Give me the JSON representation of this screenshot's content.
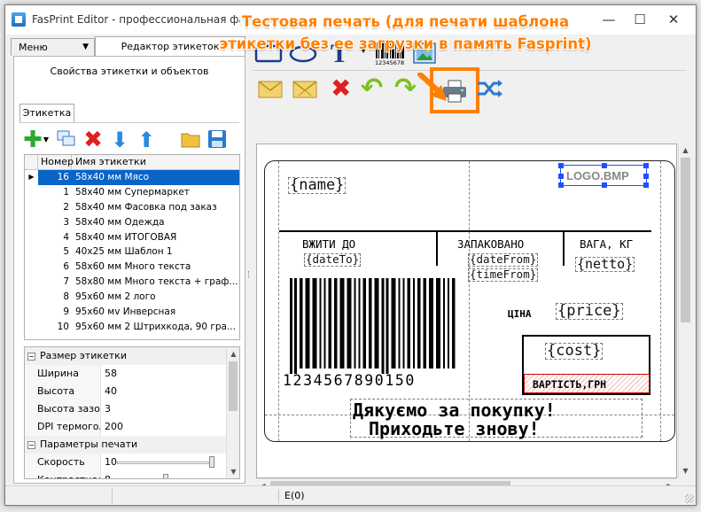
{
  "window": {
    "title": "FasPrint Editor - профессиональная фасо",
    "minimize": "—",
    "maximize": "☐",
    "close": "✕"
  },
  "overlay_caption": {
    "line1": "Тестовая печать (для печати шаблона",
    "line2": "этикетки без ее загрузки в память Fasprint)",
    "color": "#ff8000"
  },
  "tabs": {
    "menu_label": "Меню",
    "editor_label": "Редактор этикеток"
  },
  "left_panel": {
    "header": "Свойства этикетки и объектов",
    "subtab": "Этикетка",
    "grid": {
      "columns": [
        "Номер",
        "Имя этикетки"
      ],
      "rows": [
        {
          "num": "16",
          "name": "58x40 мм Мясо",
          "selected": true
        },
        {
          "num": "1",
          "name": "58x40 мм Супермаркет"
        },
        {
          "num": "2",
          "name": "58x40 мм Фасовка под заказ"
        },
        {
          "num": "3",
          "name": "58x40 мм Одежда"
        },
        {
          "num": "4",
          "name": "58x40 мм ИТОГОВАЯ"
        },
        {
          "num": "5",
          "name": "40x25 мм Шаблон 1"
        },
        {
          "num": "6",
          "name": "58x60 мм Много текста"
        },
        {
          "num": "7",
          "name": "58x80 мм Много текста + граф..."
        },
        {
          "num": "8",
          "name": "95x60 мм 2 лого"
        },
        {
          "num": "9",
          "name": "95x60 мv Инверсная"
        },
        {
          "num": "10",
          "name": "95x60 мм 2 Штрихкода, 90 гра..."
        }
      ]
    },
    "properties": {
      "cat1": "Размер этикетки",
      "width_label": "Ширина",
      "width_value": "58",
      "height_label": "Высота",
      "height_value": "40",
      "gap_label": "Высота зазор...",
      "gap_value": "3",
      "dpi_label": "DPI термогол...",
      "dpi_value": "200",
      "cat2": "Параметры печати",
      "speed_label": "Скорость",
      "speed_value": "10",
      "speed_level": 1.0,
      "contrast_label": "Контрастность",
      "contrast_value": "8",
      "contrast_level": 0.5
    }
  },
  "toolbar": {
    "icons": [
      "rectangle-tool-icon",
      "ellipse-tool-icon",
      "text-tool-icon",
      "barcode-tool-icon",
      "image-tool-icon"
    ],
    "barcode_caption": "12345678"
  },
  "label": {
    "name_field": "{name}",
    "logo_field": "LOGO.BMP",
    "use_by_title": "ВЖИТИ ДО",
    "date_to": "{dateTo}",
    "packed_title": "ЗАПАКОВАНО",
    "date_from": "{dateFrom}",
    "time_from": "{timeFrom}",
    "weight_title": "ВАГА, КГ",
    "netto": "{netto}",
    "price_title": "ЦІНА",
    "price": "{price}",
    "cost": "{cost}",
    "cost_title": "ВАРТІСТЬ,ГРН",
    "barcode_digits": "1234567890150",
    "thanks_line1": "Дякуємо за покупку!",
    "thanks_line2": "Приходьте знову!"
  },
  "status": {
    "cell": "E(0)"
  },
  "colors": {
    "highlight": "#ff8000",
    "selection": "#0a64c8"
  }
}
